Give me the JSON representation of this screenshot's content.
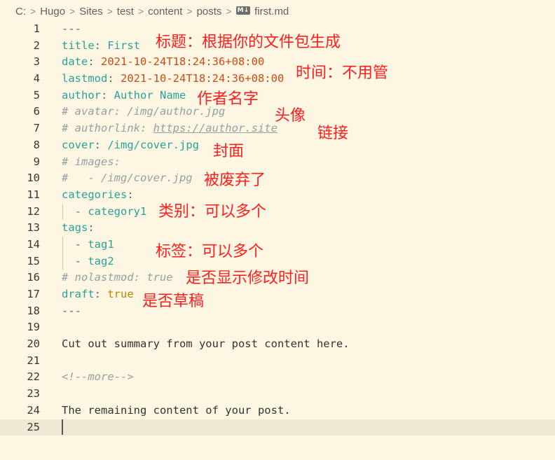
{
  "breadcrumb": {
    "items": [
      "C:",
      "Hugo",
      "Sites",
      "test",
      "content",
      "posts"
    ],
    "file_icon": "M↓",
    "file": "first.md",
    "separator": ">"
  },
  "lines": {
    "l1": "---",
    "l2_key": "title",
    "l2_colon": ": ",
    "l2_val": "First",
    "l3_key": "date",
    "l3_colon": ": ",
    "l3_val": "2021-10-24T18:24:36+08:00",
    "l4_key": "lastmod",
    "l4_colon": ": ",
    "l4_val": "2021-10-24T18:24:36+08:00",
    "l5_key": "author",
    "l5_colon": ": ",
    "l5_val": "Author Name",
    "l6": "# avatar: /img/author.jpg",
    "l7_a": "# authorlink: ",
    "l7_link": "https://author.site",
    "l8_key": "cover",
    "l8_colon": ": ",
    "l8_val": "/img/cover.jpg",
    "l9": "# images:",
    "l10": "#   - /img/cover.jpg",
    "l11_key": "categories",
    "l11_colon": ":",
    "l12_dash": "  - ",
    "l12_val": "category1",
    "l13_key": "tags",
    "l13_colon": ":",
    "l14_dash": "  - ",
    "l14_val": "tag1",
    "l15_dash": "  - ",
    "l15_val": "tag2",
    "l16": "# nolastmod: true",
    "l17_key": "draft",
    "l17_colon": ": ",
    "l17_val": "true",
    "l18": "---",
    "l20": "Cut out summary from your post content here.",
    "l22": "<!--more-->",
    "l24": "The remaining content of your post."
  },
  "annotations": {
    "title": "标题：根据你的文件包生成",
    "time": "时间：不用管",
    "author": "作者名字",
    "avatar": "头像",
    "link": "链接",
    "cover": "封面",
    "deprecated": "被废弃了",
    "categories": "类别：可以多个",
    "tags": "标签：可以多个",
    "nolastmod": "是否显示修改时间",
    "draft": "是否草稿"
  }
}
